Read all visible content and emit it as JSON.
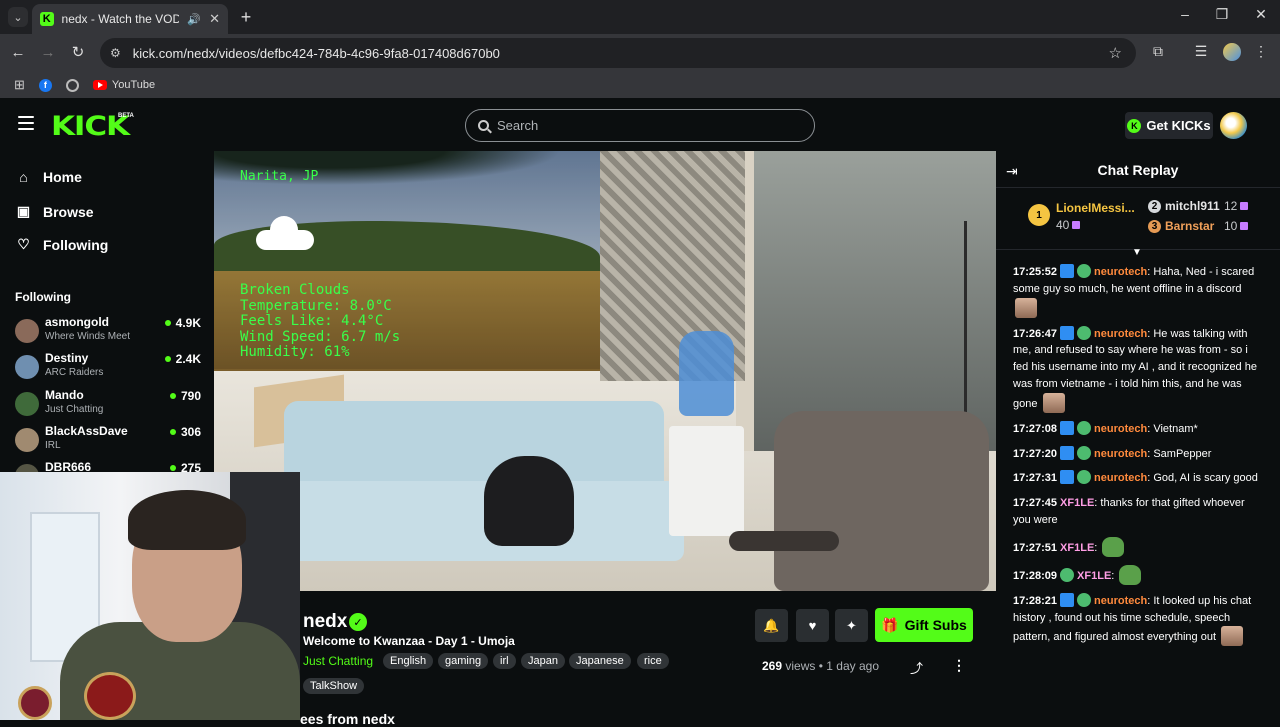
{
  "browser": {
    "tab_title": "nedx - Watch the VOD on Kick",
    "url": "kick.com/nedx/videos/defbc424-784b-4c96-9fa8-017408d670b0",
    "bookmarks": [
      {
        "label": "",
        "icon": "facebook-icon"
      },
      {
        "label": "",
        "icon": "globe-icon"
      },
      {
        "label": "YouTube",
        "icon": "youtube-icon"
      }
    ]
  },
  "header": {
    "logo": "KICK",
    "beta": "BETA",
    "search_placeholder": "Search",
    "get_kicks": "Get KICKs",
    "accent": "#53fc18"
  },
  "sidebar": {
    "nav": [
      {
        "label": "Home",
        "icon": "home-icon"
      },
      {
        "label": "Browse",
        "icon": "browse-icon"
      },
      {
        "label": "Following",
        "icon": "heart-icon"
      }
    ],
    "following_title": "Following",
    "channels": [
      {
        "name": "asmongold",
        "category": "Where Winds Meet",
        "viewers": "4.9K",
        "color": "#8a6a5a"
      },
      {
        "name": "Destiny",
        "category": "ARC Raiders",
        "viewers": "2.4K",
        "color": "#6f8fb0"
      },
      {
        "name": "Mando",
        "category": "Just Chatting",
        "viewers": "790",
        "color": "#3f6a3a"
      },
      {
        "name": "BlackAssDave",
        "category": "IRL",
        "viewers": "306",
        "color": "#a08a70"
      },
      {
        "name": "DBR666",
        "category": "",
        "viewers": "275",
        "color": "#553"
      }
    ]
  },
  "video": {
    "weather": {
      "location": "Narita, JP",
      "condition": "Broken Clouds",
      "temperature": "Temperature: 8.0°C",
      "feels_like": "Feels Like: 4.4°C",
      "wind": "Wind Speed: 6.7 m/s",
      "humidity": "Humidity: 61%"
    }
  },
  "stream": {
    "streamer": "nedx",
    "title": "Welcome to Kwanzaa - Day 1 - Umoja",
    "category": "Just Chatting",
    "tags": [
      "English",
      "gaming",
      "irl",
      "Japan",
      "Japanese",
      "rice",
      "TalkShow"
    ],
    "gift_subs": "Gift Subs",
    "views_count": "269",
    "views_label": "views",
    "separator": "•",
    "age": "1 day ago",
    "more_from": "ees from nedx"
  },
  "chat": {
    "title": "Chat Replay",
    "leaders": [
      {
        "rank": "1",
        "name": "LionelMessi...",
        "value": "40"
      },
      {
        "rank": "2",
        "name": "mitchl911",
        "value": "12"
      },
      {
        "rank": "3",
        "name": "Barnstar",
        "value": "10"
      }
    ],
    "messages": [
      {
        "time": "17:25:52",
        "user": "neurotech",
        "color": "#ff8a3d",
        "text": ": Haha, Ned - i scared some guy so much, he went offline in a discord",
        "emote": "face",
        "badges": [
          "blue",
          "green"
        ]
      },
      {
        "time": "17:26:47",
        "user": "neurotech",
        "color": "#ff8a3d",
        "text": ": He was talking with me, and refused to say where he was from - so i fed his username into my AI , and it recognized he was from vietname - i told him this, and he was gone",
        "emote": "face",
        "badges": [
          "blue",
          "green"
        ]
      },
      {
        "time": "17:27:08",
        "user": "neurotech",
        "color": "#ff8a3d",
        "text": ": Vietnam*",
        "emote": "",
        "badges": [
          "blue",
          "green"
        ]
      },
      {
        "time": "17:27:20",
        "user": "neurotech",
        "color": "#ff8a3d",
        "text": ": SamPepper",
        "emote": "",
        "badges": [
          "blue",
          "green"
        ]
      },
      {
        "time": "17:27:31",
        "user": "neurotech",
        "color": "#ff8a3d",
        "text": ": God, AI is scary good",
        "emote": "",
        "badges": [
          "blue",
          "green"
        ]
      },
      {
        "time": "17:27:45",
        "user": "XF1LE",
        "color": "#ff9ee5",
        "text": ": thanks for that gifted whoever you were",
        "emote": "",
        "badges": []
      },
      {
        "time": "17:27:51",
        "user": "XF1LE",
        "color": "#ff9ee5",
        "text": ":",
        "emote": "frog",
        "badges": []
      },
      {
        "time": "17:28:09",
        "user": "XF1LE",
        "color": "#ff9ee5",
        "text": ":",
        "emote": "frog",
        "badges": [
          "green"
        ]
      },
      {
        "time": "17:28:21",
        "user": "neurotech",
        "color": "#ff8a3d",
        "text": ": It looked up his chat history , found out his time schedule, speech pattern, and figured almost everything out",
        "emote": "face",
        "badges": [
          "blue",
          "green"
        ]
      }
    ]
  }
}
